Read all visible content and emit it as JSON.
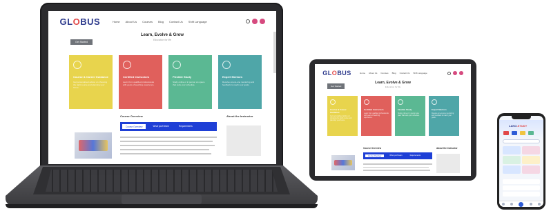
{
  "site": {
    "logo_prefix": "GL",
    "logo_o": "O",
    "logo_suffix": "BUS",
    "nav_links": [
      "Home",
      "About Us",
      "Courses",
      "Blog",
      "Contact Us",
      "Shift Language"
    ],
    "hero_title": "Learn, Evolve & Grow",
    "hero_subtitle": "Education for life",
    "cta_label": "Get Started",
    "cards": [
      {
        "title": "Course & Career Guidance",
        "desc": "Get personalised advice on choosing the right course and planning your future.",
        "color": "#e8d44d",
        "icon": "book-icon"
      },
      {
        "title": "Certified Instructors",
        "desc": "Learn from qualified professionals with years of teaching experience.",
        "color": "#e0605c",
        "icon": "trophy-icon"
      },
      {
        "title": "Flexible Study",
        "desc": "Study online or in person at a pace that suits your schedule.",
        "color": "#5bb893",
        "icon": "search-icon"
      },
      {
        "title": "Expert Mentors",
        "desc": "Receive one-to-one mentoring and feedback to reach your goals.",
        "color": "#4fa6a8",
        "icon": "trophy-icon"
      }
    ],
    "course_overview_title": "Course Overview",
    "tabs": [
      "Course Overview",
      "What you'll learn",
      "Requirements"
    ],
    "about_instructor_title": "About the Instructor"
  },
  "phone": {
    "title_prefix": "LANG",
    "title_suffix": "-STUDY"
  },
  "colors": {
    "brand_blue": "#2d3a8c",
    "accent_red": "#e14848",
    "tab_blue": "#1e3fd6",
    "pink": "#d64a7f"
  }
}
